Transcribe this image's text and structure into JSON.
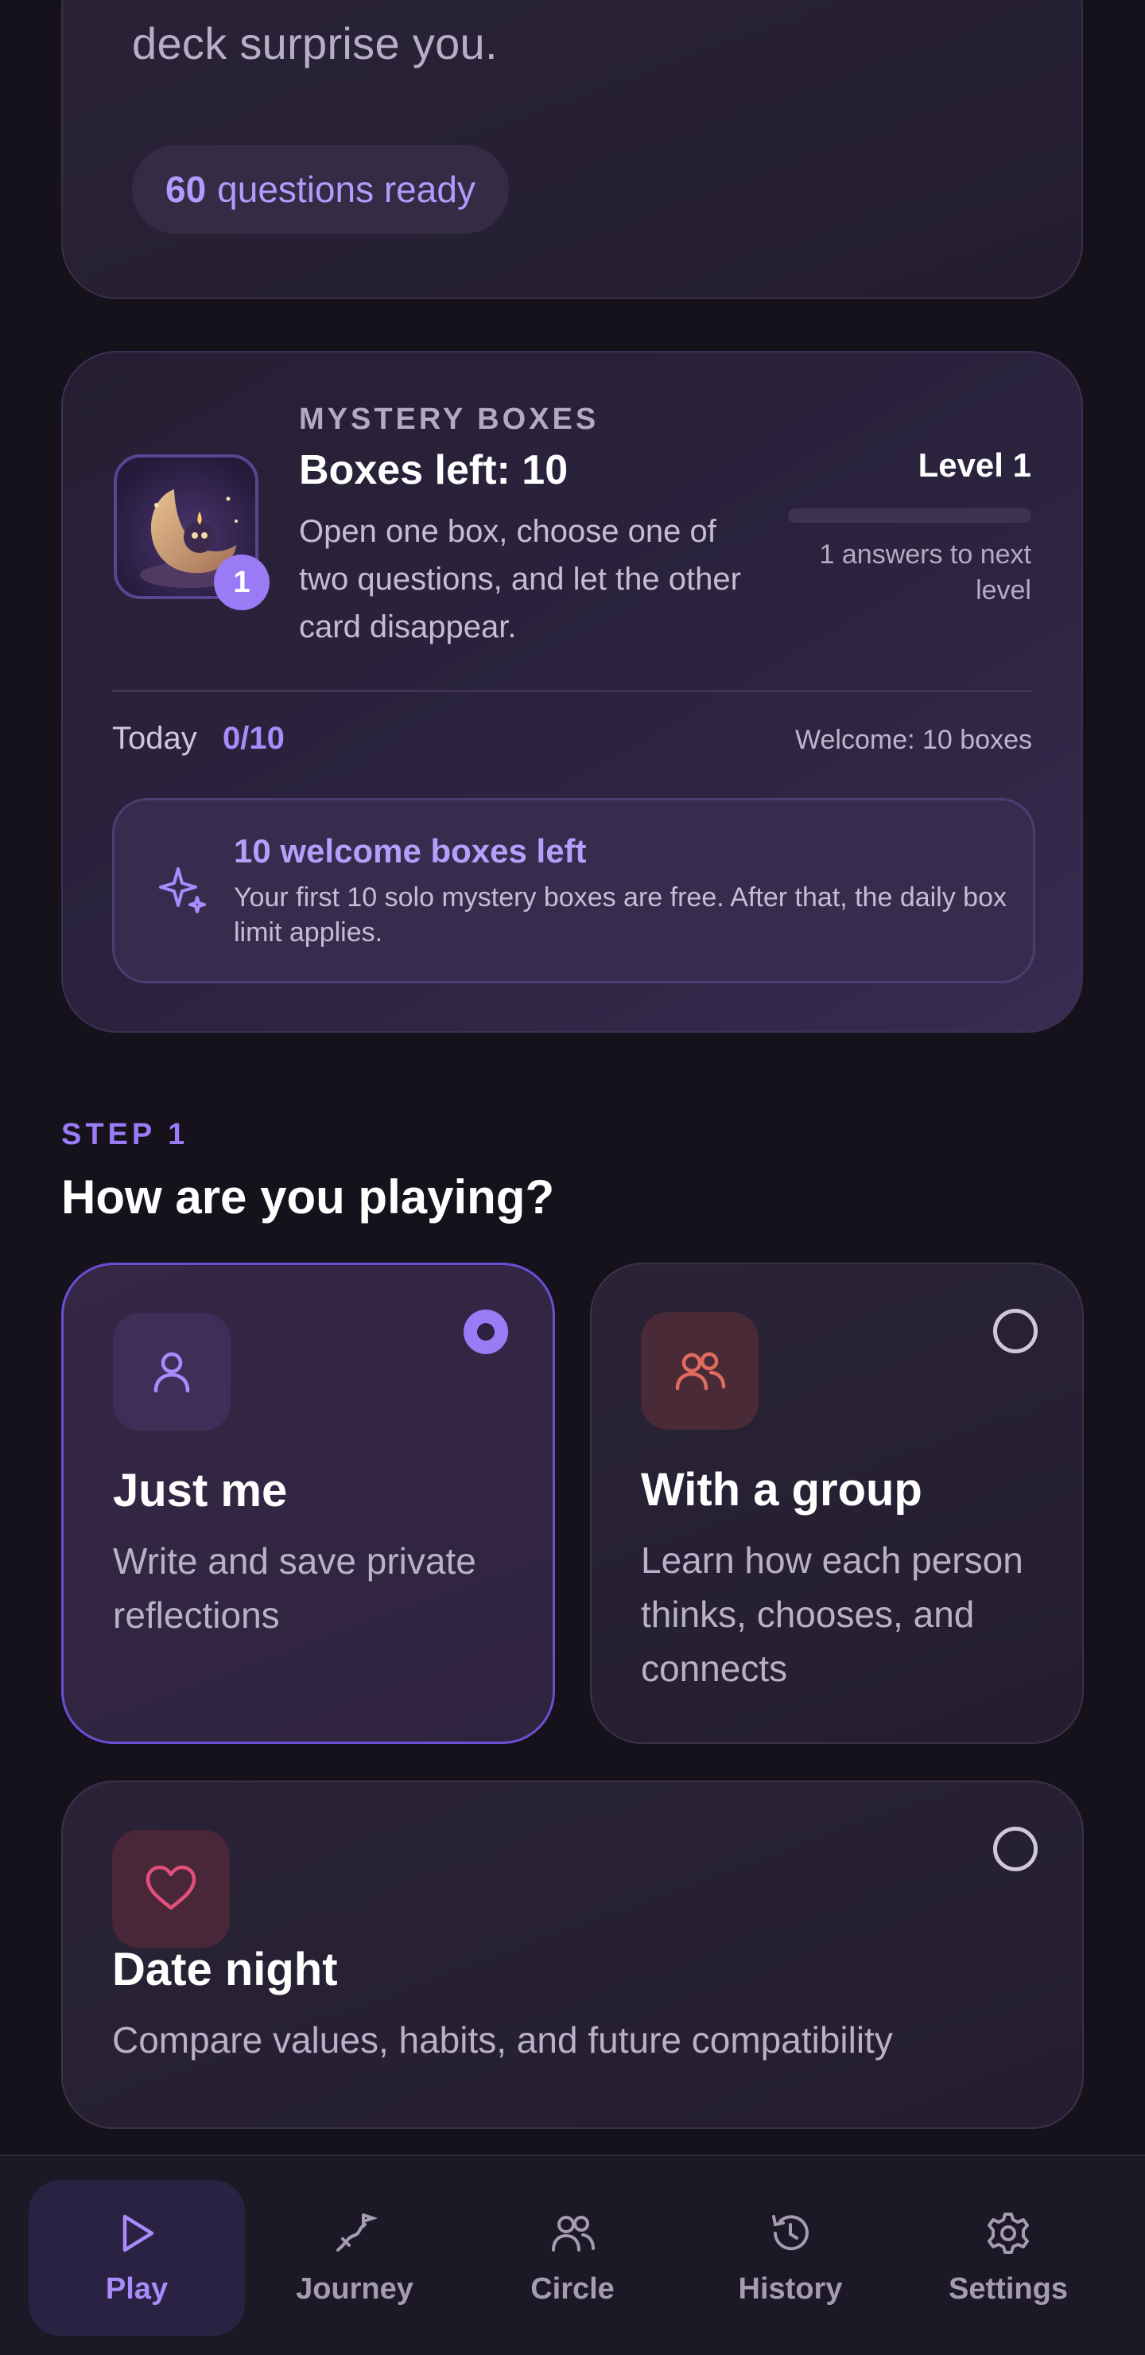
{
  "top_card": {
    "tagline": "deck surprise you.",
    "questions_count": "60",
    "questions_label": "questions ready"
  },
  "mystery": {
    "eyebrow": "MYSTERY BOXES",
    "title": "Boxes left: 10",
    "description": "Open one box, choose one of two questions, and let the other card disappear.",
    "badge": "1",
    "level_label": "Level 1",
    "level_progress_percent": 0,
    "level_note": "1 answers to next level",
    "today_label": "Today",
    "today_value": "0/10",
    "welcome_note": "Welcome: 10 boxes",
    "banner_title": "10 welcome boxes left",
    "banner_text": "Your first 10 solo mystery boxes are free. After that, the daily box limit applies."
  },
  "step": {
    "label": "STEP 1",
    "title": "How are you playing?"
  },
  "options": [
    {
      "title": "Just me",
      "description": "Write and save private reflections",
      "icon": "person-icon",
      "selected": true
    },
    {
      "title": "With a group",
      "description": "Learn how each person thinks, chooses, and connects",
      "icon": "group-icon",
      "selected": false
    },
    {
      "title": "Date night",
      "description": "Compare values, habits, and future compatibility",
      "icon": "heart-icon",
      "selected": false
    }
  ],
  "nav": [
    {
      "label": "Play",
      "icon": "play-icon",
      "active": true
    },
    {
      "label": "Journey",
      "icon": "journey-icon",
      "active": false
    },
    {
      "label": "Circle",
      "icon": "users-icon",
      "active": false
    },
    {
      "label": "History",
      "icon": "history-icon",
      "active": false
    },
    {
      "label": "Settings",
      "icon": "gear-icon",
      "active": false
    }
  ],
  "colors": {
    "accent": "#9a7bf5",
    "background": "#15121c",
    "group_icon": "#e06b5e",
    "heart_icon": "#e0507a"
  }
}
